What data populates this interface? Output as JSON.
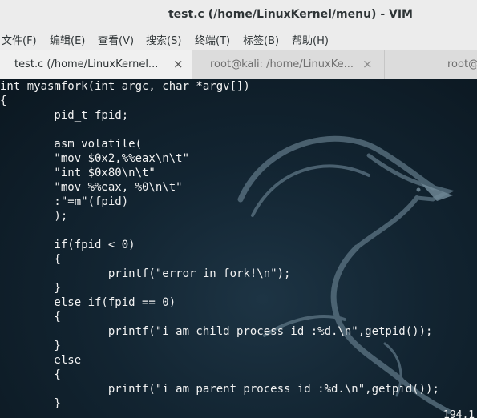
{
  "window": {
    "title": "test.c (/home/LinuxKernel/menu) - VIM"
  },
  "menu": [
    "文件(F)",
    "编辑(E)",
    "查看(V)",
    "搜索(S)",
    "终端(T)",
    "标签(B)",
    "帮助(H)"
  ],
  "tabs": [
    {
      "label": "test.c (/home/LinuxKernel...",
      "active": true,
      "close": "×"
    },
    {
      "label": "root@kali: /home/LinuxKe...",
      "active": false,
      "close": "×"
    },
    {
      "label": "root@",
      "active": false,
      "close": ""
    }
  ],
  "code_lines": [
    "int myasmfork(int argc, char *argv[])",
    "{",
    "        pid_t fpid;",
    "",
    "        asm volatile(",
    "        \"mov $0x2,%%eax\\n\\t\"",
    "        \"int $0x80\\n\\t\"",
    "        \"mov %%eax, %0\\n\\t\"",
    "        :\"=m\"(fpid)",
    "        );",
    "",
    "        if(fpid < 0)",
    "        {",
    "                printf(\"error in fork!\\n\");",
    "        }",
    "        else if(fpid == 0)",
    "        {",
    "                printf(\"i am child process id :%d.\\n\",getpid());",
    "        }",
    "        else",
    "        {",
    "                printf(\"i am parent process id :%d.\\n\",getpid());",
    "        }"
  ],
  "status": {
    "position": "194,1"
  },
  "colors": {
    "terminal_bg": "#122431",
    "text": "#f2f2f2",
    "chrome": "#ececec"
  }
}
